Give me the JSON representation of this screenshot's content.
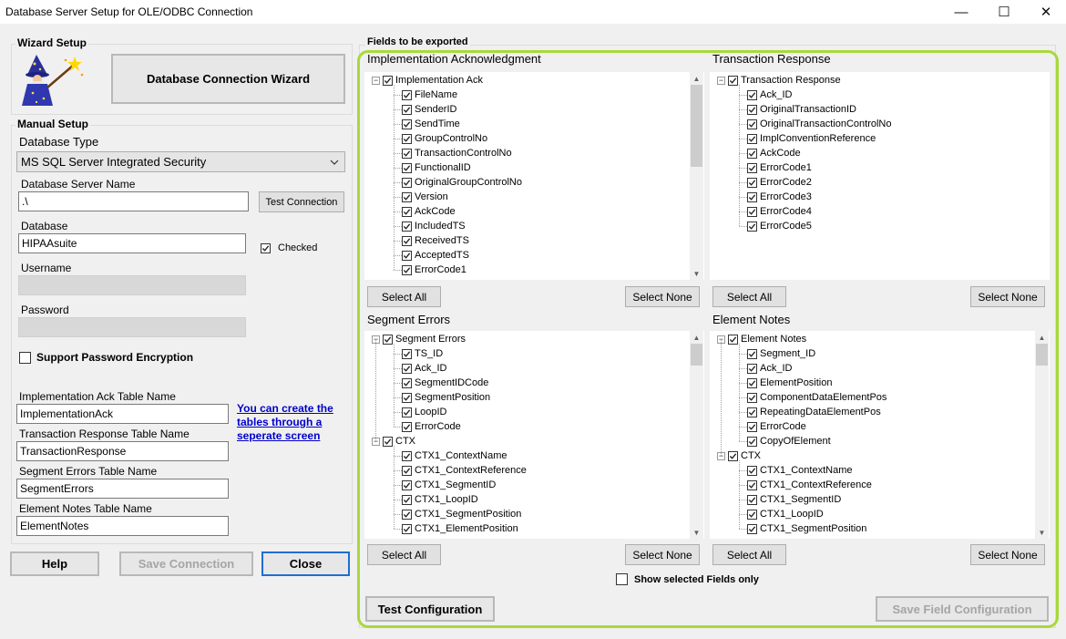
{
  "window": {
    "title": "Database Server Setup for OLE/ODBC Connection",
    "minimize_glyph": "—",
    "maximize_glyph": "☐",
    "close_glyph": "✕"
  },
  "wizard": {
    "group_label": "Wizard Setup",
    "button_label": "Database Connection Wizard"
  },
  "manual": {
    "group_label": "Manual Setup",
    "db_type_label": "Database Type",
    "db_type_value": "MS SQL Server Integrated Security",
    "server_label": "Database Server Name",
    "server_value": ".\\",
    "test_connection_label": "Test Connection",
    "database_label": "Database",
    "database_value": "HIPAAsuite",
    "checked_label": "Checked",
    "username_label": "Username",
    "password_label": "Password",
    "encryption_label": "Support Password Encryption"
  },
  "tables": {
    "ack_label": "Implementation Ack Table Name",
    "ack_value": "ImplementationAck",
    "tr_label": "Transaction Response Table Name",
    "tr_value": "TransactionResponse",
    "se_label": "Segment Errors Table Name",
    "se_value": "SegmentErrors",
    "en_label": "Element Notes Table Name",
    "en_value": "ElementNotes",
    "link_text": "You can create the tables through a seperate screen"
  },
  "bottom_buttons": {
    "help": "Help",
    "save_connection": "Save Connection",
    "close": "Close"
  },
  "fields": {
    "group_label": "Fields to be exported",
    "select_all": "Select All",
    "select_none": "Select None",
    "show_selected_only": "Show selected Fields only",
    "test_configuration": "Test Configuration",
    "save_field_configuration": "Save Field Configuration"
  },
  "panels": [
    {
      "title": "Implementation Acknowledgment",
      "rows": [
        {
          "label": "Implementation Ack",
          "level": 0
        },
        {
          "label": "FileName",
          "level": 1
        },
        {
          "label": "SenderID",
          "level": 1
        },
        {
          "label": "SendTime",
          "level": 1
        },
        {
          "label": "GroupControlNo",
          "level": 1
        },
        {
          "label": "TransactionControlNo",
          "level": 1
        },
        {
          "label": "FunctionalID",
          "level": 1
        },
        {
          "label": "OriginalGroupControlNo",
          "level": 1
        },
        {
          "label": "Version",
          "level": 1
        },
        {
          "label": "AckCode",
          "level": 1
        },
        {
          "label": "IncludedTS",
          "level": 1
        },
        {
          "label": "ReceivedTS",
          "level": 1
        },
        {
          "label": "AcceptedTS",
          "level": 1
        },
        {
          "label": "ErrorCode1",
          "level": 1
        }
      ],
      "scroll": true,
      "thumb_top": 0.0,
      "thumb_size": 0.45
    },
    {
      "title": "Transaction Response",
      "rows": [
        {
          "label": "Transaction Response",
          "level": 0
        },
        {
          "label": "Ack_ID",
          "level": 1
        },
        {
          "label": "OriginalTransactionID",
          "level": 1
        },
        {
          "label": "OriginalTransactionControlNo",
          "level": 1
        },
        {
          "label": "ImplConventionReference",
          "level": 1
        },
        {
          "label": "AckCode",
          "level": 1
        },
        {
          "label": "ErrorCode1",
          "level": 1
        },
        {
          "label": "ErrorCode2",
          "level": 1
        },
        {
          "label": "ErrorCode3",
          "level": 1
        },
        {
          "label": "ErrorCode4",
          "level": 1
        },
        {
          "label": "ErrorCode5",
          "level": 1
        }
      ],
      "scroll": false
    },
    {
      "title": "Segment Errors",
      "rows": [
        {
          "label": "Segment Errors",
          "level": 0
        },
        {
          "label": "TS_ID",
          "level": 1
        },
        {
          "label": "Ack_ID",
          "level": 1
        },
        {
          "label": "SegmentIDCode",
          "level": 1
        },
        {
          "label": "SegmentPosition",
          "level": 1
        },
        {
          "label": "LoopID",
          "level": 1
        },
        {
          "label": "ErrorCode",
          "level": 1
        },
        {
          "label": "CTX",
          "level": 0
        },
        {
          "label": "CTX1_ContextName",
          "level": 1
        },
        {
          "label": "CTX1_ContextReference",
          "level": 1
        },
        {
          "label": "CTX1_SegmentID",
          "level": 1
        },
        {
          "label": "CTX1_LoopID",
          "level": 1
        },
        {
          "label": "CTX1_SegmentPosition",
          "level": 1
        },
        {
          "label": "CTX1_ElementPosition",
          "level": 1
        }
      ],
      "scroll": true,
      "thumb_top": 0.0,
      "thumb_size": 0.12
    },
    {
      "title": "Element Notes",
      "rows": [
        {
          "label": "Element Notes",
          "level": 0
        },
        {
          "label": "Segment_ID",
          "level": 1
        },
        {
          "label": "Ack_ID",
          "level": 1
        },
        {
          "label": "ElementPosition",
          "level": 1
        },
        {
          "label": "ComponentDataElementPos",
          "level": 1
        },
        {
          "label": "RepeatingDataElementPos",
          "level": 1
        },
        {
          "label": "ErrorCode",
          "level": 1
        },
        {
          "label": "CopyOfElement",
          "level": 1
        },
        {
          "label": "CTX",
          "level": 0
        },
        {
          "label": "CTX1_ContextName",
          "level": 1
        },
        {
          "label": "CTX1_ContextReference",
          "level": 1
        },
        {
          "label": "CTX1_SegmentID",
          "level": 1
        },
        {
          "label": "CTX1_LoopID",
          "level": 1
        },
        {
          "label": "CTX1_SegmentPosition",
          "level": 1
        }
      ],
      "scroll": true,
      "thumb_top": 0.0,
      "thumb_size": 0.12
    }
  ],
  "colors": {
    "highlight": "#a8d93a",
    "link": "#0000cc",
    "focus": "#1e6fd0"
  }
}
